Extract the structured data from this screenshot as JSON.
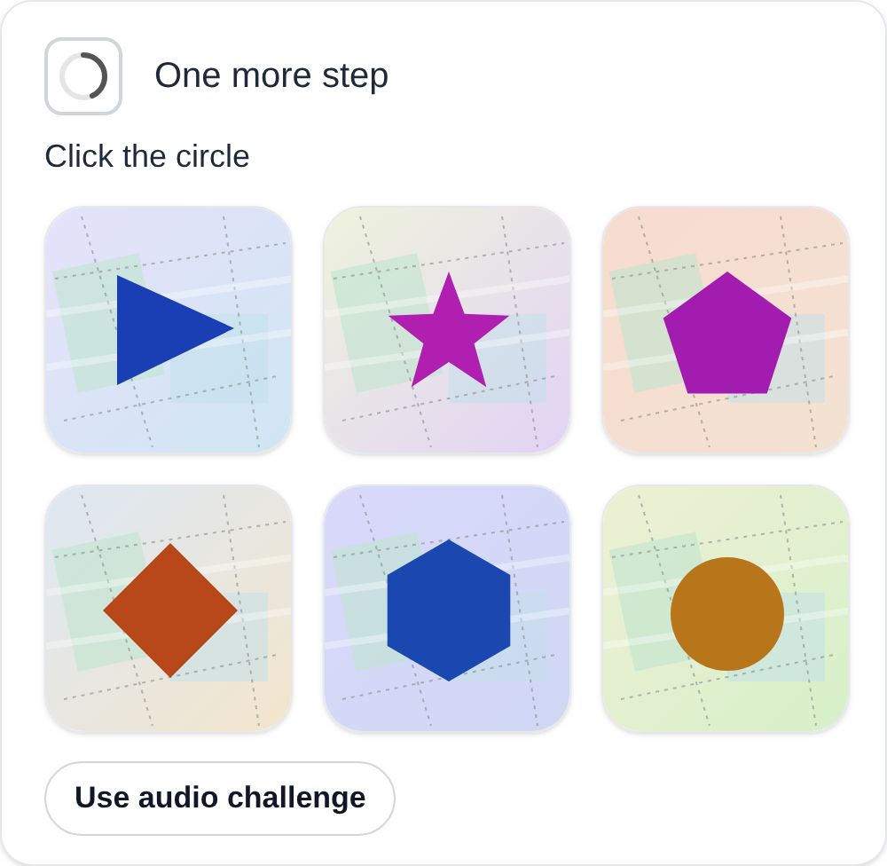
{
  "header": {
    "title": "One more step"
  },
  "prompt": "Click the circle",
  "tiles": [
    {
      "kind": "triangle",
      "color": "#1a3fb5",
      "selected": false
    },
    {
      "kind": "star",
      "color": "#b01fb0",
      "selected": false
    },
    {
      "kind": "pentagon",
      "color": "#a21cb0",
      "selected": false
    },
    {
      "kind": "diamond",
      "color": "#b8481a",
      "selected": false
    },
    {
      "kind": "hexagon",
      "color": "#1a47b0",
      "selected": false
    },
    {
      "kind": "circle",
      "color": "#b8761a",
      "selected": false
    }
  ],
  "audio_button": "Use audio challenge"
}
